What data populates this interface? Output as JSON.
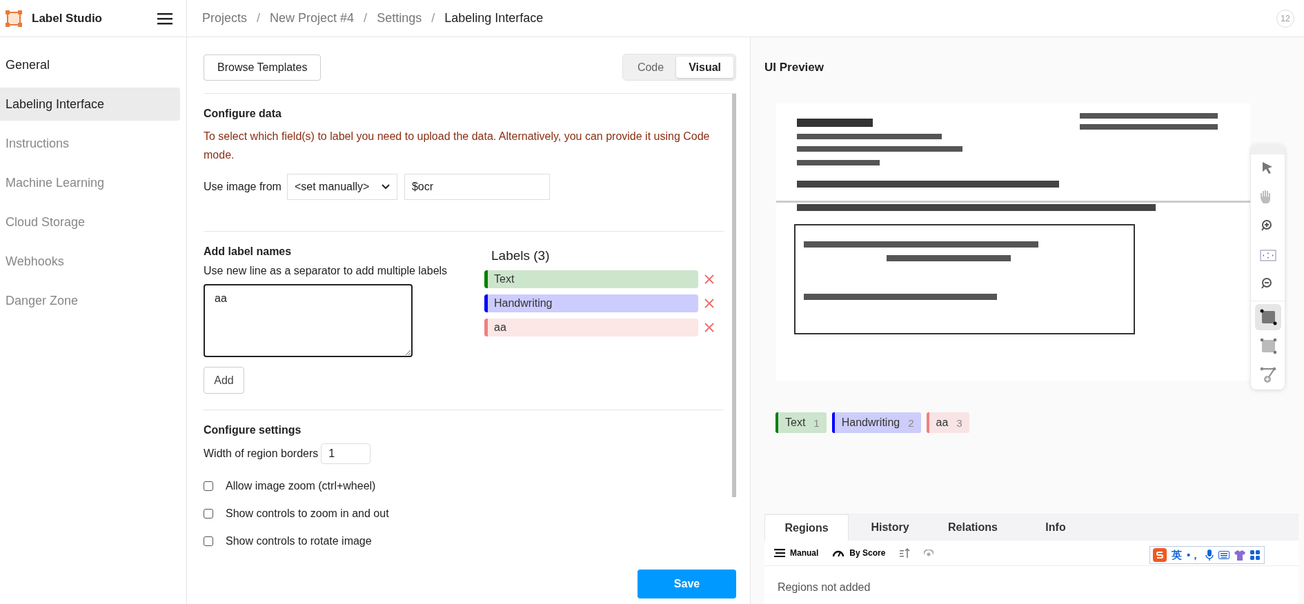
{
  "app": {
    "name": "Label Studio"
  },
  "breadcrumbs": [
    {
      "label": "Projects"
    },
    {
      "separator": "/",
      "label": "New Project #4"
    },
    {
      "separator": "/",
      "label": "Settings"
    },
    {
      "separator": "/",
      "label": "Labeling Interface"
    }
  ],
  "notifications": {
    "count": "12"
  },
  "sidebar": {
    "items": [
      {
        "label": "General",
        "selected": false,
        "disabled": false
      },
      {
        "label": "Labeling Interface",
        "selected": true,
        "disabled": false
      },
      {
        "label": "Instructions",
        "selected": false,
        "disabled": true
      },
      {
        "label": "Machine Learning",
        "selected": false,
        "disabled": true
      },
      {
        "label": "Cloud Storage",
        "selected": false,
        "disabled": true
      },
      {
        "label": "Webhooks",
        "selected": false,
        "disabled": true
      },
      {
        "label": "Danger Zone",
        "selected": false,
        "disabled": true
      }
    ]
  },
  "editor": {
    "browse_button": "Browse Templates",
    "mode_toggle": [
      {
        "label": "Code",
        "selected": false
      },
      {
        "label": "Visual",
        "selected": true
      }
    ],
    "configure_data": {
      "title": "Configure data",
      "description": "To select which field(s) to label you need to upload the data. Alternatively, you can provide it using Code mode.",
      "image_source_label": "Use image from",
      "image_source_select": "<set manually>",
      "image_source_value": "$ocr"
    },
    "add_labels": {
      "title": "Add label names",
      "hint": "Use new line as a separator to add multiple labels",
      "textarea_value": "aa",
      "add_button": "Add",
      "labels_title": "Labels (3)",
      "labels": [
        {
          "name": "Text",
          "color": "#008000"
        },
        {
          "name": "Handwriting",
          "color": "#0000ff"
        },
        {
          "name": "aa",
          "color": "#f08080"
        }
      ]
    },
    "configure_settings": {
      "title": "Configure settings",
      "border_width_label": "Width of region borders",
      "border_width_value": "1",
      "options": [
        {
          "label": "Allow image zoom (ctrl+wheel)",
          "checked": false
        },
        {
          "label": "Show controls to zoom in and out",
          "checked": false
        },
        {
          "label": "Show controls to rotate image",
          "checked": false
        }
      ]
    },
    "save_button": "Save"
  },
  "preview": {
    "title": "UI Preview",
    "tools": [
      {
        "kind": "pointer",
        "selected": false,
        "disabled": false
      },
      {
        "kind": "hand",
        "selected": false,
        "disabled": true
      },
      {
        "kind": "zoom-in",
        "selected": false,
        "disabled": false
      },
      {
        "kind": "fit",
        "selected": false,
        "disabled": false
      },
      {
        "kind": "zoom-out",
        "selected": false,
        "disabled": false
      },
      {
        "kind": "rectangle",
        "selected": true,
        "disabled": false
      },
      {
        "kind": "rectangle-3point",
        "selected": false,
        "disabled": false
      },
      {
        "kind": "polygon",
        "selected": false,
        "disabled": false
      }
    ],
    "labels": [
      {
        "name": "Text",
        "hotkey": "1",
        "color": "#008000"
      },
      {
        "name": "Handwriting",
        "hotkey": "2",
        "color": "#0000ff"
      },
      {
        "name": "aa",
        "hotkey": "3",
        "color": "#f08080"
      }
    ],
    "tabs": [
      {
        "label": "Regions",
        "selected": true
      },
      {
        "label": "History",
        "selected": false
      },
      {
        "label": "Relations",
        "selected": false
      },
      {
        "label": "Info",
        "selected": false
      }
    ],
    "region_toolbar": {
      "manual": "Manual",
      "by_score": "By Score"
    },
    "empty_message": "Regions not added"
  },
  "ime_toolbar": {
    "mode": "英",
    "punctuation": "•，"
  }
}
